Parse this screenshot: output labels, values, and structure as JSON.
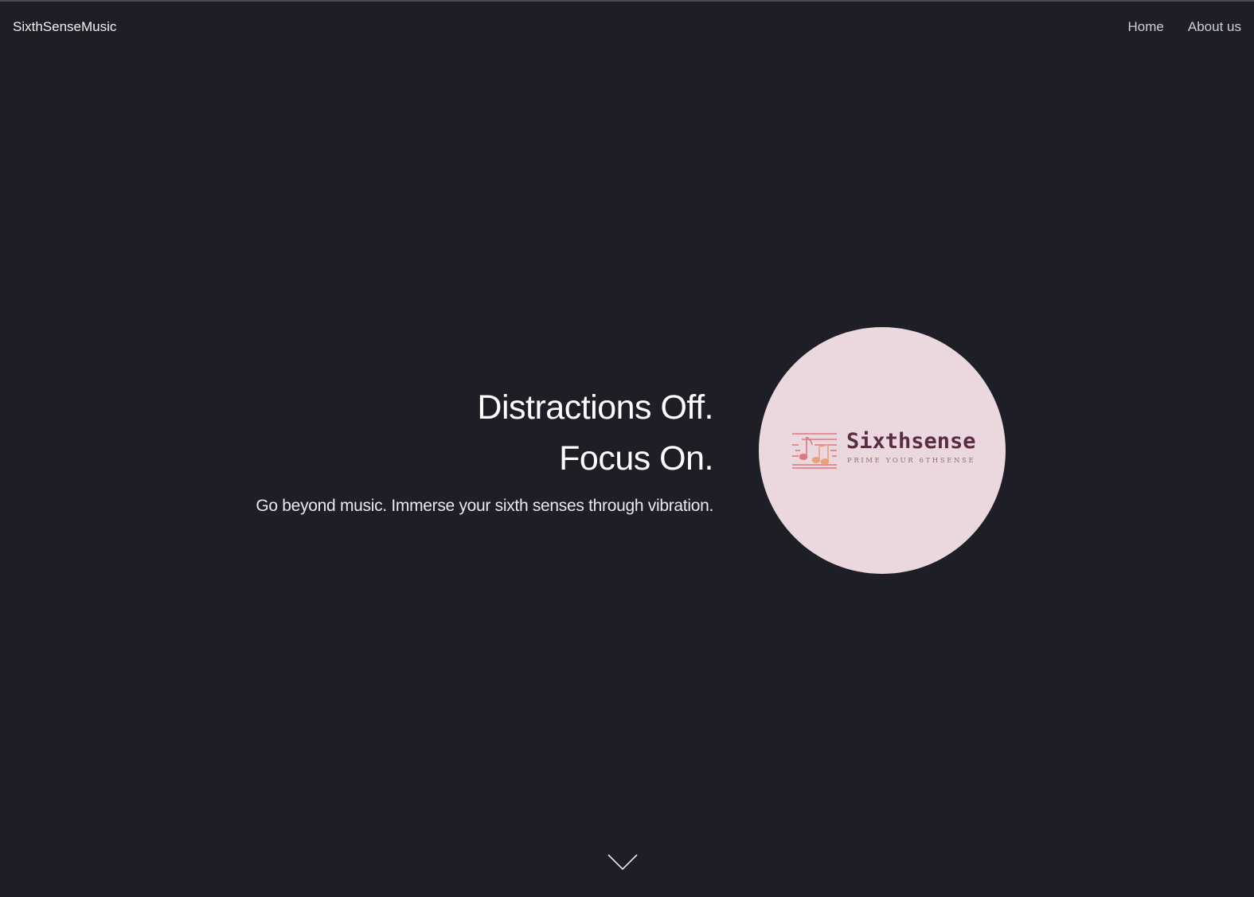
{
  "header": {
    "brand": "SixthSenseMusic",
    "nav": [
      {
        "label": "Home"
      },
      {
        "label": "About us"
      }
    ]
  },
  "hero": {
    "headline_line1": "Distractions Off.",
    "headline_line2": "Focus On.",
    "tagline": "Go beyond music. Immerse your sixth senses through vibration."
  },
  "logo": {
    "name": "Sixthsense",
    "subtitle": "PRIME YOUR 6THSENSE",
    "icon": "music-staff-icon",
    "circle_color": "#ebd8df",
    "name_color": "#5b2c45",
    "mark_color": "#e0767f"
  },
  "scroll": {
    "icon": "chevron-down-icon"
  },
  "colors": {
    "background": "#1d1e26",
    "text": "#ffffff"
  }
}
